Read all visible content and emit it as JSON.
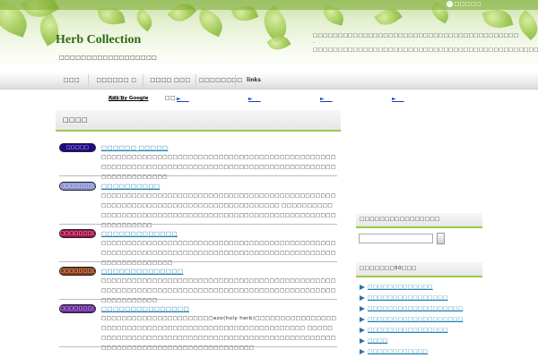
{
  "header": {
    "top_link": "□□□□□",
    "site_title": "Herb Collection",
    "tagline": "□□□□□□□□□□□□□□□□□□",
    "description": "□□□□□□□□□□□□□□□□□□□□□□□□□□□□□□□□□□□□□□□□□ · □□□□□□□□□□□□□□□□□□□□□□□□□□□□□□□□□□□□□□□□□□□□□□□□□□□□□□□□□□□□□□□"
  },
  "nav": {
    "items": [
      {
        "label": "□□□"
      },
      {
        "label": "□□□□□□ □ □□□"
      },
      {
        "label": "□□□□ □□□ □□"
      },
      {
        "label": "□□□□□□□□"
      },
      {
        "label": "links"
      }
    ]
  },
  "ads": {
    "label": "Ads by Google",
    "links": [
      "►___",
      "►___",
      "►___",
      "►___"
    ]
  },
  "main": {
    "heading": "□□□□",
    "items": [
      {
        "badge": "□□□□□",
        "badge_color": "#1d0a8a",
        "title": "□□□□□□ □□□□□",
        "body": "□□□□□□□□□□□□□□□□□□□□□□□□□□□□□□□□□□□□□□□□□□□□□□□□□□□□□□□□□□□□□□□□□□□□□□□□□□□□□□□□□□□□□□□□□□□□□□□□□□□□□□□□□"
      },
      {
        "badge": "□□□□□□□□□□",
        "badge_color": "#8c92d6",
        "title": "□□□□□□□□□□",
        "body": "□□□□□□□□□□□□□□□□□□□□□□□□□□□□□□□□□□□□□□□□□□□□□□□□□□□□□□□□□□□□□□□□□□□□□□□□□□□□□□□□□ □□□□□□□□□□□□□□□□□□□□□□□□□□□□□□□□□□□□□□□□□□□□□□□□□□□□□□□□□□□□□□□□□□"
      },
      {
        "badge": "□□□□□□□□□□",
        "badge_color": "#a3104a",
        "title": "□□□□□□□□□□□□□",
        "body": "□□□□□□□□□□□□□□□□□□□□□□□□□□□□□□□□□□□□□□□□□□□□□□□□□□□□□□□□□□□□□□□□□□□□□□□□□□□□□□□□□□□□□□□□□□□□□□□□□□□□□□□□□□"
      },
      {
        "badge": "□□□□□□□□□□",
        "badge_color": "#8a3a12",
        "title": "□□□□□□□□□□□□□□",
        "body": "□□□□□□□□□□□□□□□□□□□□□□□□□□□□□□□□□□□□□□□□□□□□□□□□□□□□□□□□□□□□□□□□□□□□□□□□□□□□□□□□□□□□□□□□□□□□□□□□□□□□□□□"
      },
      {
        "badge": "□□□□□□□□□□",
        "badge_color": "#6a2a9a",
        "title": "□□□□□□□□□□□□□□□",
        "body": "□□□□□□□□□□□□□□□□□□□□□□ezo(holy herb)□□□□□□□□□□□□□□□□□□□□□□□□□□□□□□□□□□□□□□□□□□□□□□□□□□□□□□□□ □□□□□□□□□□□□□□□□□□□□□□□□□□□□□□□□□□□□□□□□□□□□□□□□□□□□□□□□□□□□□□□□□□□□□□□□□□□□□□□□□"
      }
    ]
  },
  "sidebar": {
    "search_heading": "□□□□□□□□□□□□□□□□",
    "popular_heading": "□□□□□□□50□□□",
    "links": [
      "□□□□□□□□□□□□□",
      "□□□□□□□□□□□□□□□□",
      "□□□□□□□□□□□□□□□□□□□",
      "□□□□□□□□□□□□□□□□□□□",
      "□□□□□□□□□□□□□□□□",
      "□□□□",
      "□□□□□□□□□□□□"
    ]
  }
}
